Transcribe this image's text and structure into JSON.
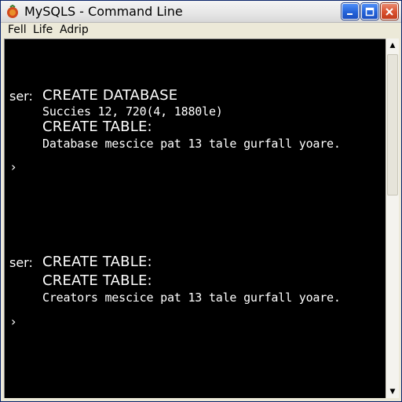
{
  "window": {
    "title": "MySQLS - Command Line",
    "controls": {
      "minimize": "_",
      "maximize": "□",
      "close": "✕"
    }
  },
  "menu": {
    "items": [
      "Fell",
      "Life",
      "Adrip"
    ]
  },
  "console": {
    "block1": {
      "prompt": "ser:",
      "cmd1": "CREATE DATABASE",
      "out1": "Succies 12, 720(4, 1880le)",
      "cmd2": "CREATE TABLE:",
      "out2": "Database mescice pat 13 tale gurfall yoare.",
      "caret": "›"
    },
    "block2": {
      "prompt": "ser:",
      "cmd1": "CREATE TABLE:",
      "cmd2": "CREATE TABLE:",
      "out1": "Creators mescice pat 13 tale gurfall yoare.",
      "caret": "›"
    }
  },
  "scrollbar": {
    "up": "▲",
    "down": "▼"
  }
}
